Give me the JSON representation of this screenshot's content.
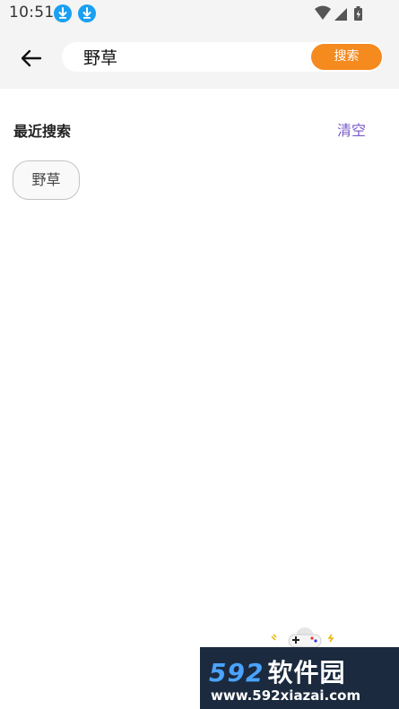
{
  "status_bar": {
    "time": "10:51",
    "icons": [
      "download-icon",
      "download-icon",
      "wifi-icon",
      "signal-icon",
      "battery-charging-icon"
    ]
  },
  "header": {
    "back_icon": "arrow-left-icon",
    "search_value": "野草",
    "search_button_label": "搜索"
  },
  "recent": {
    "title": "最近搜索",
    "clear_label": "清空",
    "items": [
      "野草"
    ]
  },
  "watermark": {
    "logo_number": "592",
    "logo_text": "软件园",
    "url": "www.592xiazai.com"
  },
  "colors": {
    "accent_orange": "#f58a1e",
    "clear_purple": "#7a5ac9",
    "header_bg": "#f4f4f4",
    "download_blue": "#1aa0f2"
  }
}
